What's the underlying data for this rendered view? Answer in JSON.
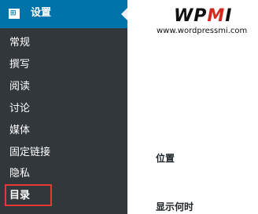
{
  "sidebar": {
    "header": {
      "label": "设置"
    },
    "items": [
      {
        "label": "常规"
      },
      {
        "label": "撰写"
      },
      {
        "label": "阅读"
      },
      {
        "label": "讨论"
      },
      {
        "label": "媒体"
      },
      {
        "label": "固定链接"
      },
      {
        "label": "隐私"
      },
      {
        "label": "目录"
      }
    ]
  },
  "logo": {
    "brand_dark_1": "WP",
    "brand_red": "M",
    "brand_dark_2": "I",
    "url": "www.wordpressmi.com"
  },
  "main": {
    "labels": {
      "position": "位置",
      "show_time": "显示何时"
    }
  },
  "colors": {
    "sidebar_bg": "#32373c",
    "header_bg": "#0073aa",
    "highlight": "#e53935",
    "brand_red": "#d7281f"
  }
}
